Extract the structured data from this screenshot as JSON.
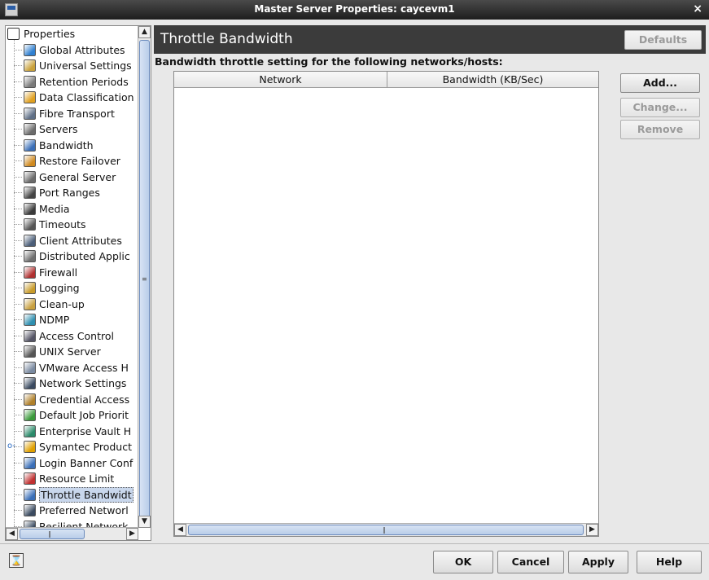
{
  "window": {
    "title": "Master Server Properties: caycevm1",
    "close_glyph": "×",
    "app_icon": "window-menu-icon"
  },
  "tree": {
    "root_label": "Properties",
    "items": [
      {
        "label": "Global Attributes",
        "icon": "globe-icon",
        "color": "#2f7fd0"
      },
      {
        "label": "Universal Settings",
        "icon": "universal-settings-icon",
        "color": "#c9a13a"
      },
      {
        "label": "Retention Periods",
        "icon": "retention-icon",
        "color": "#7a7a7a"
      },
      {
        "label": "Data Classification",
        "icon": "data-classification-icon",
        "color": "#e0a020"
      },
      {
        "label": "Fibre Transport",
        "icon": "fibre-transport-icon",
        "color": "#5f6f86"
      },
      {
        "label": "Servers",
        "icon": "servers-icon",
        "color": "#6b6b6b"
      },
      {
        "label": "Bandwidth",
        "icon": "bandwidth-icon",
        "color": "#3a6fb8"
      },
      {
        "label": "Restore Failover",
        "icon": "restore-failover-icon",
        "color": "#d08a20"
      },
      {
        "label": "General Server",
        "icon": "general-server-icon",
        "color": "#6b6b6b"
      },
      {
        "label": "Port Ranges",
        "icon": "port-ranges-icon",
        "color": "#444444"
      },
      {
        "label": "Media",
        "icon": "media-icon",
        "color": "#3a3a3a"
      },
      {
        "label": "Timeouts",
        "icon": "timeouts-icon",
        "color": "#555555"
      },
      {
        "label": "Client Attributes",
        "icon": "client-attributes-icon",
        "color": "#4b5e78"
      },
      {
        "label": "Distributed Applic",
        "icon": "distributed-app-icon",
        "color": "#707070"
      },
      {
        "label": "Firewall",
        "icon": "firewall-icon",
        "color": "#b03030"
      },
      {
        "label": "Logging",
        "icon": "logging-icon",
        "color": "#c89b2a"
      },
      {
        "label": "Clean-up",
        "icon": "clean-up-icon",
        "color": "#c8a040"
      },
      {
        "label": "NDMP",
        "icon": "ndmp-icon",
        "color": "#2e8fb0"
      },
      {
        "label": "Access Control",
        "icon": "access-control-icon",
        "color": "#556"
      },
      {
        "label": "UNIX Server",
        "icon": "unix-server-icon",
        "color": "#555"
      },
      {
        "label": "VMware Access H",
        "icon": "vmware-icon",
        "color": "#7a8aa0"
      },
      {
        "label": "Network Settings",
        "icon": "network-settings-icon",
        "color": "#3a4a60"
      },
      {
        "label": "Credential Access",
        "icon": "credential-icon",
        "color": "#b0802a"
      },
      {
        "label": "Default Job Priorit",
        "icon": "job-priority-icon",
        "color": "#3a9a3a"
      },
      {
        "label": "Enterprise Vault H",
        "icon": "enterprise-vault-icon",
        "color": "#2a8a6a"
      },
      {
        "label": "Symantec Product",
        "icon": "symantec-check-icon",
        "color": "#e0a000"
      },
      {
        "label": "Login Banner Conf",
        "icon": "login-banner-icon",
        "color": "#3a6fb8"
      },
      {
        "label": "Resource Limit",
        "icon": "resource-limit-icon",
        "color": "#c03030"
      },
      {
        "label": "Throttle Bandwidt",
        "icon": "throttle-bandwidth-icon",
        "color": "#3a6fb8"
      },
      {
        "label": "Preferred Networl",
        "icon": "preferred-network-icon",
        "color": "#3a4a60"
      },
      {
        "label": "Resilient Network",
        "icon": "resilient-network-icon",
        "color": "#3a4a60"
      }
    ],
    "selected_index": 28
  },
  "panel": {
    "heading": "Throttle Bandwidth",
    "defaults_label": "Defaults",
    "subtitle": "Bandwidth throttle setting for the following networks/hosts:",
    "columns": [
      "Network",
      "Bandwidth (KB/Sec)"
    ],
    "add_label": "Add...",
    "change_label": "Change...",
    "remove_label": "Remove"
  },
  "footer": {
    "ok_label": "OK",
    "cancel_label": "Cancel",
    "apply_label": "Apply",
    "help_label": "Help",
    "status_icon": "hourglass-icon",
    "status_glyph": "⌛"
  }
}
